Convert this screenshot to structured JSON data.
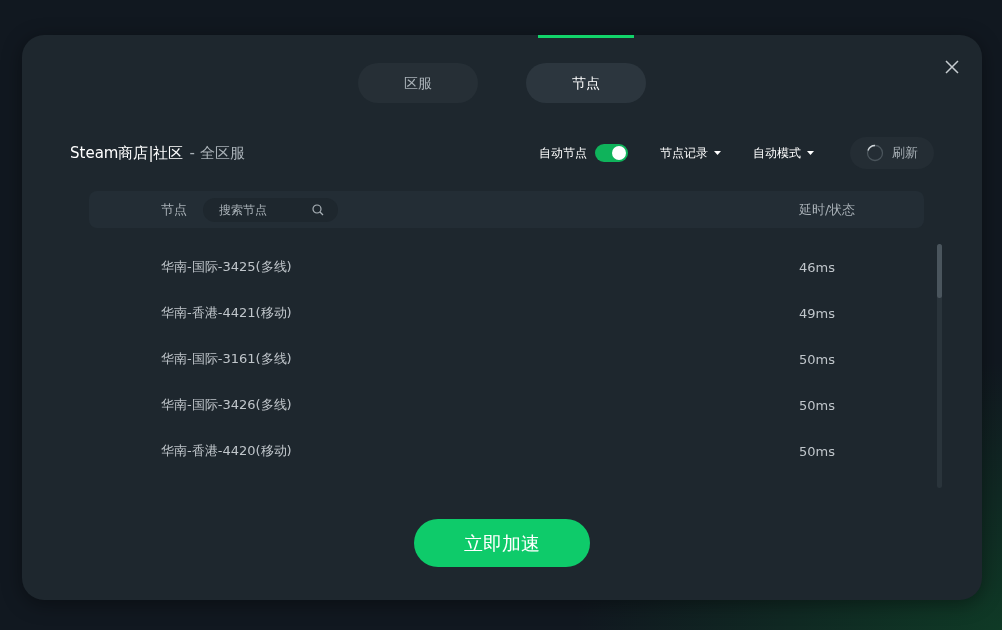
{
  "tabs": [
    {
      "label": "区服",
      "selected": false
    },
    {
      "label": "节点",
      "selected": true
    }
  ],
  "header": {
    "game": "Steam商店|社区",
    "region": "- 全区服"
  },
  "controls": {
    "auto_node": {
      "label": "自动节点",
      "on": true
    },
    "dropdowns": [
      "节点记录",
      "自动模式"
    ],
    "refresh": "刷新"
  },
  "table": {
    "node_column": "节点",
    "search": {
      "placeholder": "搜索节点"
    },
    "latency_column": "延时/状态",
    "rows": [
      {
        "node": "华南-国际-3425(多线)",
        "latency": "46ms"
      },
      {
        "node": "华南-香港-4421(移动)",
        "latency": "49ms"
      },
      {
        "node": "华南-国际-3161(多线)",
        "latency": "50ms"
      },
      {
        "node": "华南-国际-3426(多线)",
        "latency": "50ms"
      },
      {
        "node": "华南-香港-4420(移动)",
        "latency": "50ms"
      }
    ]
  },
  "action_button": "立即加速"
}
